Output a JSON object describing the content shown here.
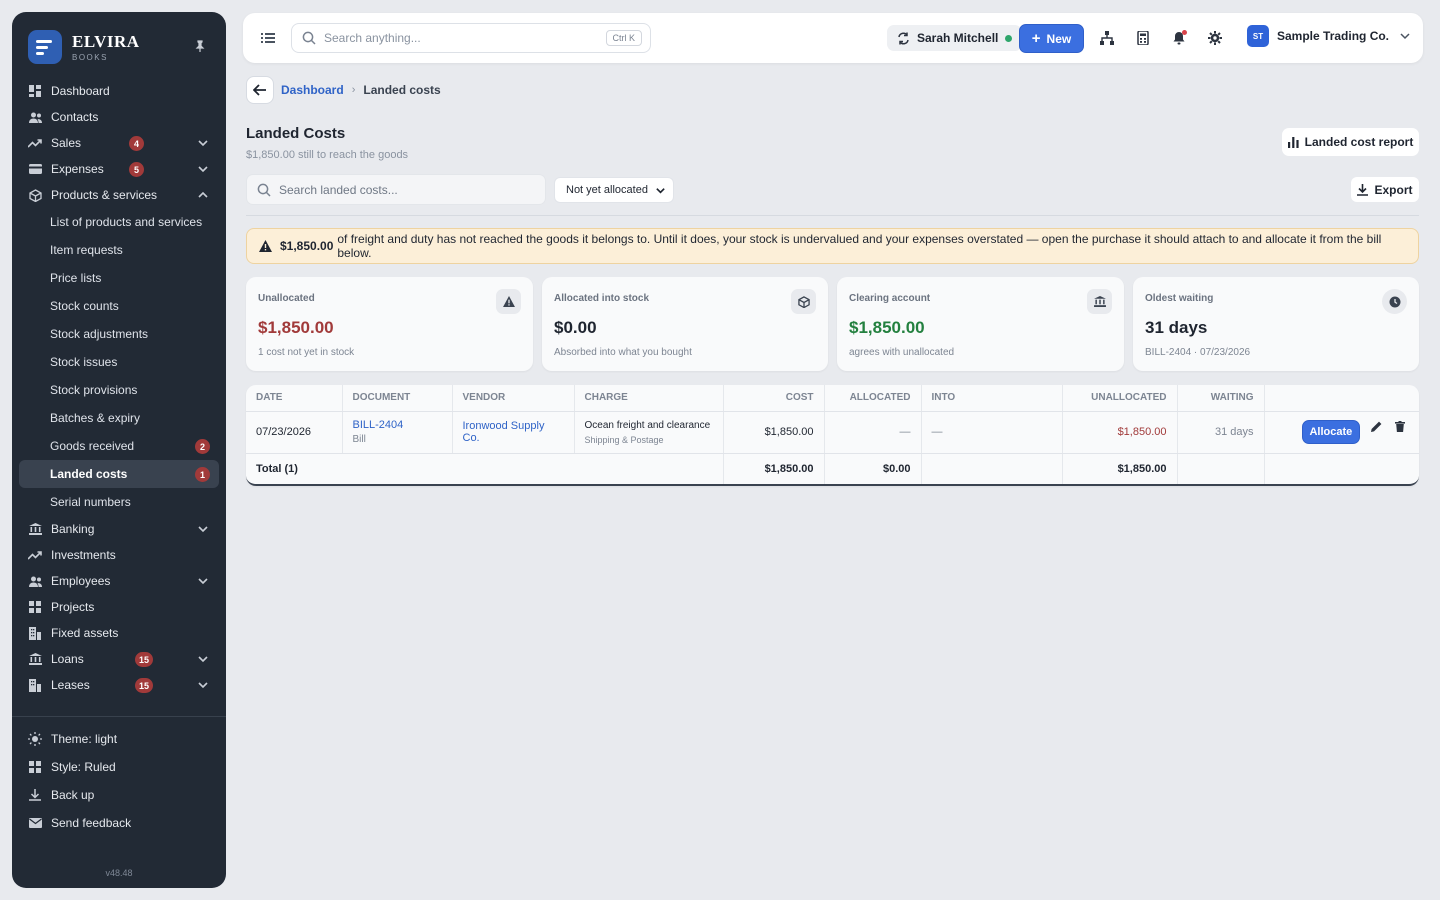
{
  "brand": {
    "name": "ELVIRA",
    "sub": "BOOKS"
  },
  "sidebar": {
    "items": [
      {
        "label": "Dashboard",
        "icon": "dashboard-icon"
      },
      {
        "label": "Contacts",
        "icon": "contacts-icon"
      },
      {
        "label": "Sales",
        "icon": "sales-icon",
        "badge": "4"
      },
      {
        "label": "Expenses",
        "icon": "expenses-icon",
        "badge": "5"
      },
      {
        "label": "Products & services",
        "icon": "box-icon"
      }
    ],
    "sub_items": [
      {
        "label": "List of products and services"
      },
      {
        "label": "Item requests"
      },
      {
        "label": "Price lists"
      },
      {
        "label": "Stock counts"
      },
      {
        "label": "Stock adjustments"
      },
      {
        "label": "Stock issues"
      },
      {
        "label": "Stock provisions"
      },
      {
        "label": "Batches & expiry"
      },
      {
        "label": "Goods received",
        "badge": "2"
      },
      {
        "label": "Landed costs",
        "badge": "1"
      },
      {
        "label": "Serial numbers"
      }
    ],
    "items_after": [
      {
        "label": "Banking"
      },
      {
        "label": "Investments"
      },
      {
        "label": "Employees"
      },
      {
        "label": "Projects"
      },
      {
        "label": "Fixed assets"
      },
      {
        "label": "Loans",
        "badge": "15"
      },
      {
        "label": "Leases",
        "badge": "15"
      }
    ],
    "bottom": [
      {
        "label": "Theme: light"
      },
      {
        "label": "Style: Ruled"
      },
      {
        "label": "Back up"
      },
      {
        "label": "Send feedback"
      }
    ],
    "version": "v48.48"
  },
  "topbar": {
    "search_placeholder": "Search anything...",
    "shortcut": "Ctrl K",
    "user": "Sarah Mitchell",
    "new_label": "New",
    "company_initials": "ST",
    "company": "Sample Trading Co."
  },
  "breadcrumb": {
    "parent": "Dashboard",
    "current": "Landed costs"
  },
  "page": {
    "title": "Landed Costs",
    "subtitle": "$1,850.00 still to reach the goods",
    "report_label": "Landed cost report",
    "search_placeholder": "Search landed costs...",
    "filter_value": "Not yet allocated",
    "export_label": "Export"
  },
  "alert": {
    "amount": "$1,850.00",
    "text": "of freight and duty has not reached the goods it belongs to. Until it does, your stock is undervalued and your expenses overstated — open the purchase it should attach to and allocate it from the bill below."
  },
  "cards": [
    {
      "label": "Unallocated",
      "value": "$1,850.00",
      "note": "1 cost not yet in stock",
      "color": "#a13a3a"
    },
    {
      "label": "Allocated into stock",
      "value": "$0.00",
      "note": "Absorbed into what you bought",
      "color": "#1f2530"
    },
    {
      "label": "Clearing account",
      "value": "$1,850.00",
      "note": "agrees with unallocated",
      "color": "#23803f"
    },
    {
      "label": "Oldest waiting",
      "value": "31 days",
      "note": "BILL-2404 · 07/23/2026",
      "color": "#1f2530"
    }
  ],
  "table": {
    "headers": [
      "Date",
      "Document",
      "Vendor",
      "Charge",
      "Cost",
      "Allocated",
      "Into",
      "Unallocated",
      "Waiting"
    ],
    "row": {
      "date": "07/23/2026",
      "document": "BILL-2404",
      "document_type": "Bill",
      "vendor": "Ironwood Supply Co.",
      "charge": "Ocean freight and clearance",
      "charge_account": "Shipping & Postage",
      "cost": "$1,850.00",
      "allocated": "—",
      "into": "—",
      "unallocated": "$1,850.00",
      "waiting": "31 days",
      "action": "Allocate"
    },
    "total": {
      "label": "Total (1)",
      "cost": "$1,850.00",
      "allocated": "$0.00",
      "unallocated": "$1,850.00"
    }
  }
}
